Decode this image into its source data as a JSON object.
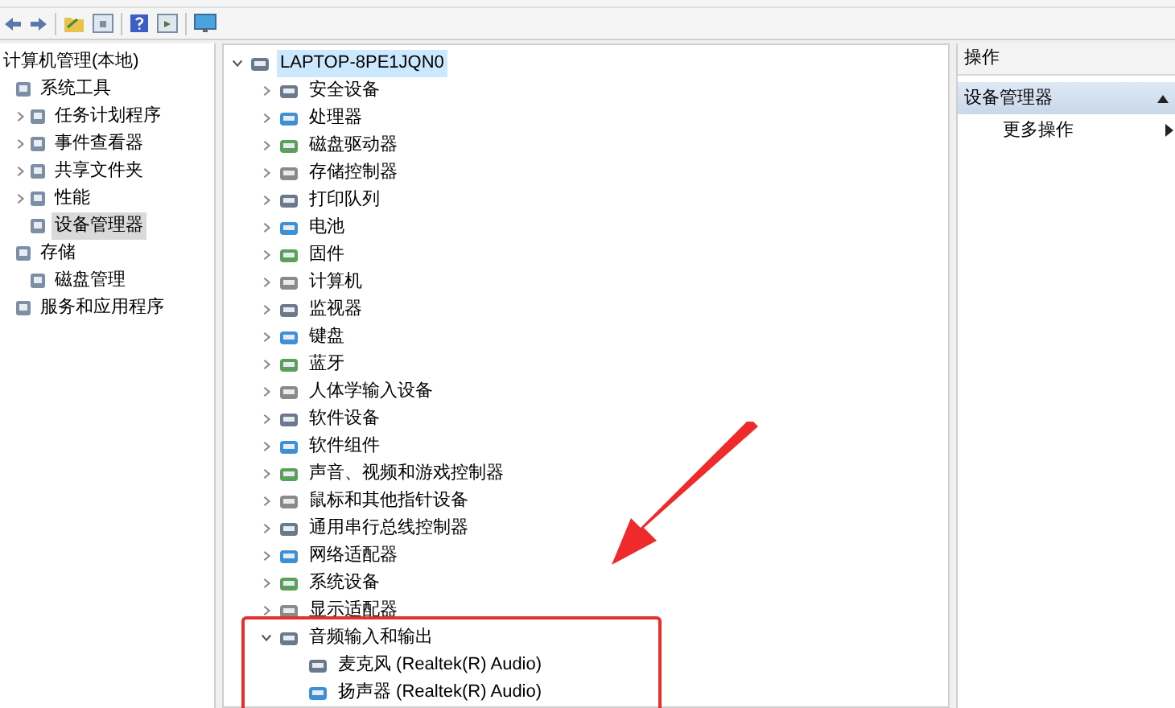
{
  "left_tree": [
    {
      "label": "计算机管理(本地)",
      "selected": false,
      "children": [
        {
          "label": "系统工具",
          "selected": false,
          "children": [
            {
              "label": "任务计划程序",
              "selected": false,
              "expanded": false
            },
            {
              "label": "事件查看器",
              "selected": false,
              "expanded": false
            },
            {
              "label": "共享文件夹",
              "selected": false,
              "expanded": false
            },
            {
              "label": "性能",
              "selected": false,
              "expanded": false
            },
            {
              "label": "设备管理器",
              "selected": true
            }
          ]
        },
        {
          "label": "存储",
          "selected": false,
          "children": [
            {
              "label": "磁盘管理",
              "selected": false
            }
          ]
        },
        {
          "label": "服务和应用程序",
          "selected": false
        }
      ]
    }
  ],
  "device_tree": [
    {
      "label": "LAPTOP-8PE1JQN0",
      "selected": true,
      "expanded": true,
      "children": [
        {
          "label": "安全设备",
          "selected": false,
          "expanded": false
        },
        {
          "label": "处理器",
          "selected": false,
          "expanded": false
        },
        {
          "label": "磁盘驱动器",
          "selected": false,
          "expanded": false
        },
        {
          "label": "存储控制器",
          "selected": false,
          "expanded": false
        },
        {
          "label": "打印队列",
          "selected": false,
          "expanded": false
        },
        {
          "label": "电池",
          "selected": false,
          "expanded": false
        },
        {
          "label": "固件",
          "selected": false,
          "expanded": false
        },
        {
          "label": "计算机",
          "selected": false,
          "expanded": false
        },
        {
          "label": "监视器",
          "selected": false,
          "expanded": false
        },
        {
          "label": "键盘",
          "selected": false,
          "expanded": false
        },
        {
          "label": "蓝牙",
          "selected": false,
          "expanded": false
        },
        {
          "label": "人体学输入设备",
          "selected": false,
          "expanded": false
        },
        {
          "label": "软件设备",
          "selected": false,
          "expanded": false
        },
        {
          "label": "软件组件",
          "selected": false,
          "expanded": false
        },
        {
          "label": "声音、视频和游戏控制器",
          "selected": false,
          "expanded": false
        },
        {
          "label": "鼠标和其他指针设备",
          "selected": false,
          "expanded": false
        },
        {
          "label": "通用串行总线控制器",
          "selected": false,
          "expanded": false
        },
        {
          "label": "网络适配器",
          "selected": false,
          "expanded": false
        },
        {
          "label": "系统设备",
          "selected": false,
          "expanded": false
        },
        {
          "label": "显示适配器",
          "selected": false,
          "expanded": false
        },
        {
          "label": "音频输入和输出",
          "selected": false,
          "expanded": true,
          "children": [
            {
              "label": "麦克风 (Realtek(R) Audio)",
              "selected": false
            },
            {
              "label": "扬声器 (Realtek(R) Audio)",
              "selected": false
            }
          ]
        }
      ]
    }
  ],
  "actions_panel": {
    "title": "操作",
    "section": {
      "label": "设备管理器",
      "expanded": true
    },
    "items": [
      {
        "label": "更多操作"
      }
    ]
  }
}
